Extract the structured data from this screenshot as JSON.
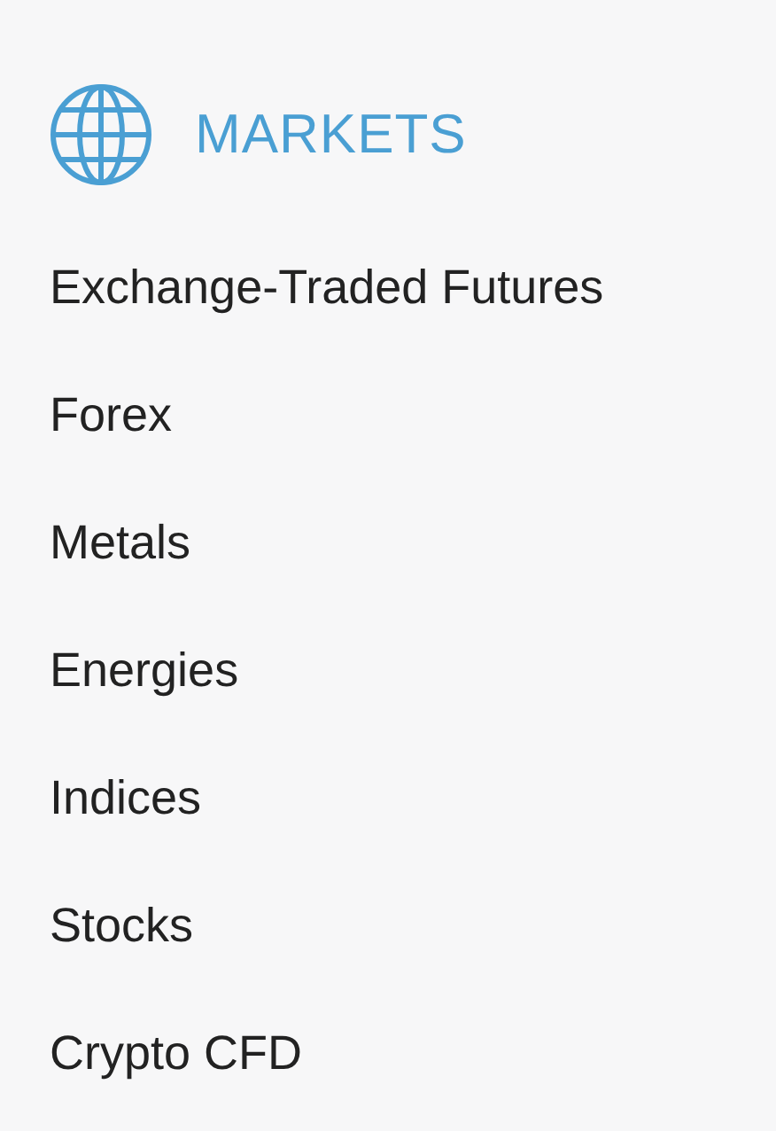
{
  "header": {
    "title": "MARKETS"
  },
  "items": [
    {
      "label": "Exchange-Traded Futures"
    },
    {
      "label": "Forex"
    },
    {
      "label": "Metals"
    },
    {
      "label": "Energies"
    },
    {
      "label": "Indices"
    },
    {
      "label": "Stocks"
    },
    {
      "label": "Crypto CFD"
    }
  ]
}
